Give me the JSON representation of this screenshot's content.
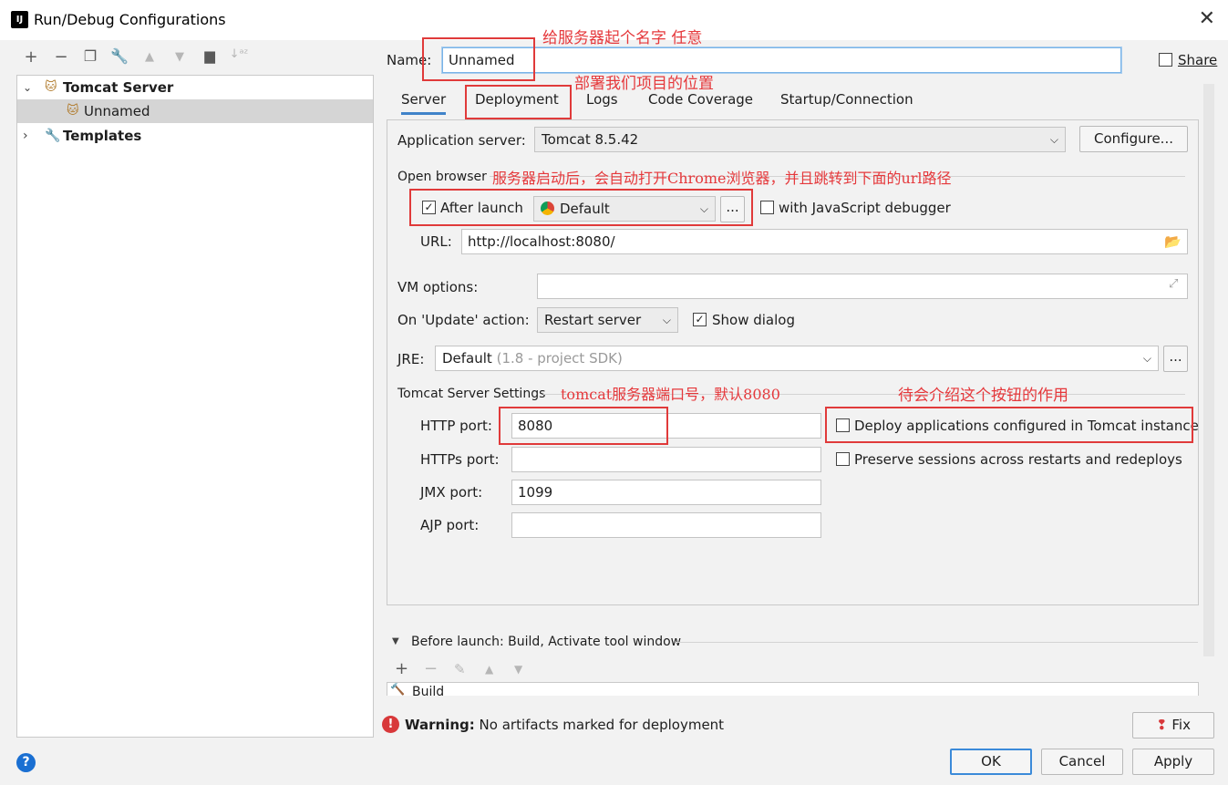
{
  "window": {
    "title": "Run/Debug Configurations",
    "icon_text": "IJ"
  },
  "left_toolbar": {
    "icons": [
      "plus-icon",
      "minus-icon",
      "copy-icon",
      "wrench-icon",
      "arrow-up-icon",
      "arrow-down-icon",
      "folder-add-icon",
      "sort-az-icon"
    ]
  },
  "tree": {
    "root": "Tomcat Server",
    "child": "Unnamed",
    "templates": "Templates"
  },
  "name_row": {
    "label": "Name:",
    "value": "Unnamed",
    "share_label": "Share"
  },
  "tabs": [
    "Server",
    "Deployment",
    "Logs",
    "Code Coverage",
    "Startup/Connection"
  ],
  "server": {
    "app_server_label": "Application server:",
    "app_server_value": "Tomcat 8.5.42",
    "configure_label": "Configure...",
    "open_browser_label": "Open browser",
    "after_launch_label": "After launch",
    "browser_value": "Default",
    "dots_label": "...",
    "js_debugger_label": "with JavaScript debugger",
    "url_label": "URL:",
    "url_value": "http://localhost:8080/",
    "vm_label": "VM options:",
    "vm_value": "",
    "on_update_label": "On 'Update' action:",
    "on_update_value": "Restart server",
    "show_dialog_label": "Show dialog",
    "jre_label": "JRE:",
    "jre_value": "Default",
    "jre_hint": "(1.8 - project SDK)",
    "tomcat_settings_label": "Tomcat Server Settings",
    "http_port_label": "HTTP port:",
    "http_port_value": "8080",
    "https_port_label": "HTTPs port:",
    "https_port_value": "",
    "jmx_port_label": "JMX port:",
    "jmx_port_value": "1099",
    "ajp_port_label": "AJP port:",
    "ajp_port_value": "",
    "deploy_apps_label": "Deploy applications configured in Tomcat instance",
    "preserve_sessions_label": "Preserve sessions across restarts and redeploys"
  },
  "before_launch": {
    "header": "Before launch: Build, Activate tool window",
    "item": "Build"
  },
  "warning": {
    "bold": "Warning:",
    "text": "No artifacts marked for deployment",
    "fix_label": "Fix"
  },
  "buttons": {
    "ok": "OK",
    "cancel": "Cancel",
    "apply": "Apply"
  },
  "annotations": {
    "name_note": "给服务器起个名字  任意",
    "deploy_note": "部署我们项目的位置",
    "browser_note": "服务器启动后，会自动打开Chrome浏览器，并且跳转到下面的url路径",
    "port_note": "tomcat服务器端口号，默认8080",
    "deploy_btn_note": "待会介绍这个按钮的作用"
  },
  "colors": {
    "accent": "#4083c9",
    "annotation_red": "#e03a3a",
    "help_blue": "#1a6fd2"
  }
}
